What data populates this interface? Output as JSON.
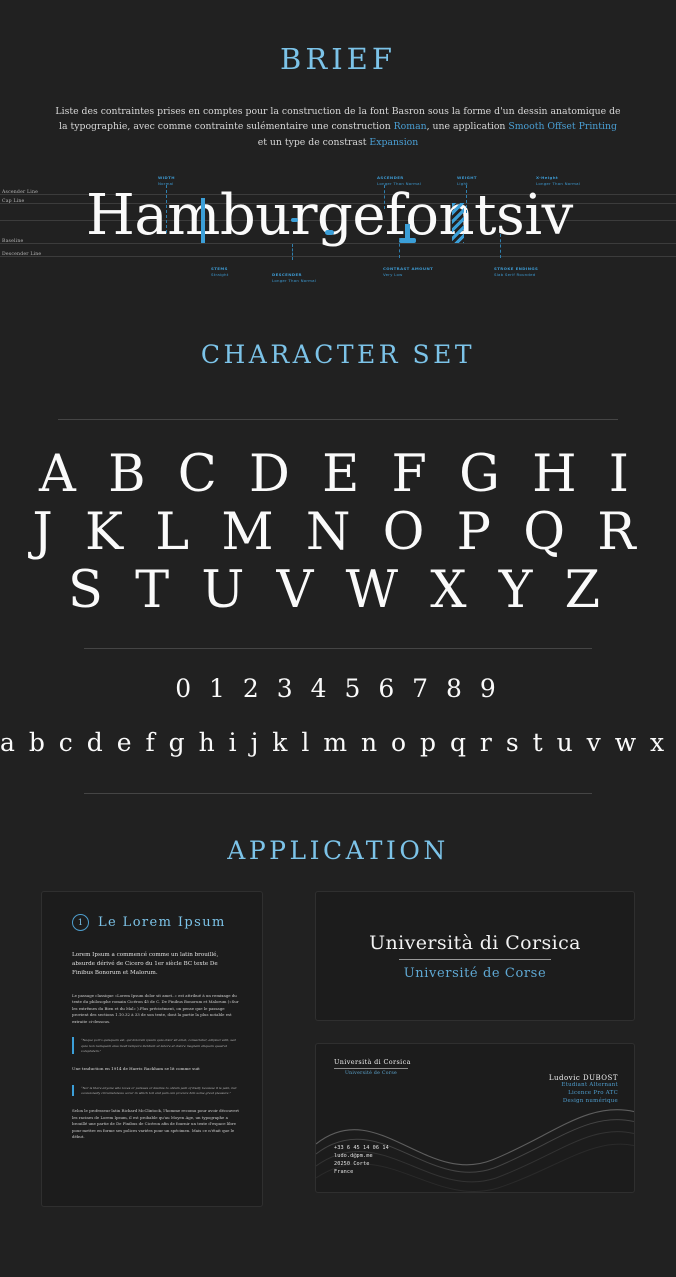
{
  "theme": {
    "background": "#212121",
    "accent": "#7cc3e8",
    "accent_deep": "#3b9fd8",
    "text": "#e8e8e8",
    "card_background": "#1c1c1c",
    "rule": "#454545"
  },
  "brief": {
    "title": "BRIEF",
    "line1_a": "Liste des contraintes prises en comptes pour la construction de la font Basron sous la forme d'un",
    "line2_a": "dessin anatomique de la typographie, avec comme contrainte sulémentaire une construction ",
    "link_roman": "Roman",
    "line2_b": ",",
    "line3_a": "une application ",
    "link_smooth": "Smooth Offset Printing",
    "line3_b": " et un type de constrast ",
    "link_expansion": "Expansion"
  },
  "anatomy": {
    "specimen_prefix": "Hamburgefontsiv",
    "specimen_accent": "|",
    "guides": [
      {
        "label": "Ascender Line"
      },
      {
        "label": "Cap Line"
      },
      {
        "label": "Baseline"
      },
      {
        "label": "Descender Line"
      }
    ],
    "annotations": [
      {
        "key": "width",
        "title": "WIDTH",
        "value": "Normal"
      },
      {
        "key": "ascender",
        "title": "ASCENDER",
        "value": "Longer Than Normal"
      },
      {
        "key": "weight",
        "title": "WEIGHT",
        "value": "Light"
      },
      {
        "key": "x-height",
        "title": "X-Height",
        "value": "Longer Than Normal"
      },
      {
        "key": "stems",
        "title": "STEMS",
        "value": "Straight"
      },
      {
        "key": "descender",
        "title": "DESCENDER",
        "value": "Longer Than Normal"
      },
      {
        "key": "contrast-amount",
        "title": "CONTRAST AMOUNT",
        "value": "Very Low"
      },
      {
        "key": "stroke-endings",
        "title": "STROKE ENDINGS",
        "value": "Slab Serif Rounded"
      }
    ]
  },
  "character_set": {
    "title": "CHARACTER SET",
    "uppercase_rows": [
      "A B C D E F G H I",
      "J K L M N O P Q R",
      "S T U V W X Y Z"
    ],
    "numerals": "0 1 2 3 4 5 6 7 8 9",
    "lowercase": "a b c d e f g h i j k l m n o p q r s t u v w x y z"
  },
  "application": {
    "title": "APPLICATION",
    "lorem_card": {
      "number": "1",
      "title": "Le Lorem Ipsum",
      "lead": "Lorem Ipsum a commencé comme un latin brouillé, absurde dérivé de Cicero du 1er siècle BC texte De Finibus Bonorum et Malorum.",
      "paragraph1": "Le passage classique «Lorem Ipsum dolor sit amet..» est attribué à un remixage du texte du philosophe romain Cicéron 45 de C. De Finibus Bonorum et Malorum («Sur les extrêmes du Bien et du Mal» ).Plus précisément, on pense que le passage provient des sections 1.10.32 à 33 de son texte, dont la partie la plus notable est extraite ci-dessous.",
      "quote1": "“Neque porro quisquam est, qui dolorem ipsum quia dolor sit amet, consectetur, adipisci velit, sed quia non numquam eius modi tempora incidunt ut labore et dolore magnam aliquam quaerat voluptatem.”",
      "note": "Une traduction en 1914 de Harris Rackham se lit comme suit",
      "quote2": "“Nor is there anyone who loves or pursues or desires to obtain pain of itself, because it is pain, but occasionally circumstances occur in which toil and pain can procure him some great pleasure.”",
      "paragraph2": "Selon le professeur latin Richard McClintock, l'homme recomu pour avoir découvert les racines de Lorem Ipsum, il est probable qu'au Moyen Age, un typographe a brouillé une partie de De Finibus de Cicéron afin de fournir un texte d'espace libre pour mettre en forme ses polices variées pour un spécimen. Mais ce n'était que le début."
    },
    "university_card": {
      "name": "Università di Corsica",
      "subtitle": "Université de Corse"
    },
    "business_card": {
      "logo_main": "Università di Corsica",
      "logo_sub": "Université de Corse",
      "person_name": "Ludovic DUBOST",
      "person_role_line1": "Etudiant Alternant",
      "person_role_line2": "Licence Pro ATC",
      "person_role_line3": "Design numérique",
      "contact_phone": "+33 6 45 14 06 14",
      "contact_email": "ludo.d@pm.me",
      "contact_zip": "20250 Corte",
      "contact_country": "France"
    }
  }
}
